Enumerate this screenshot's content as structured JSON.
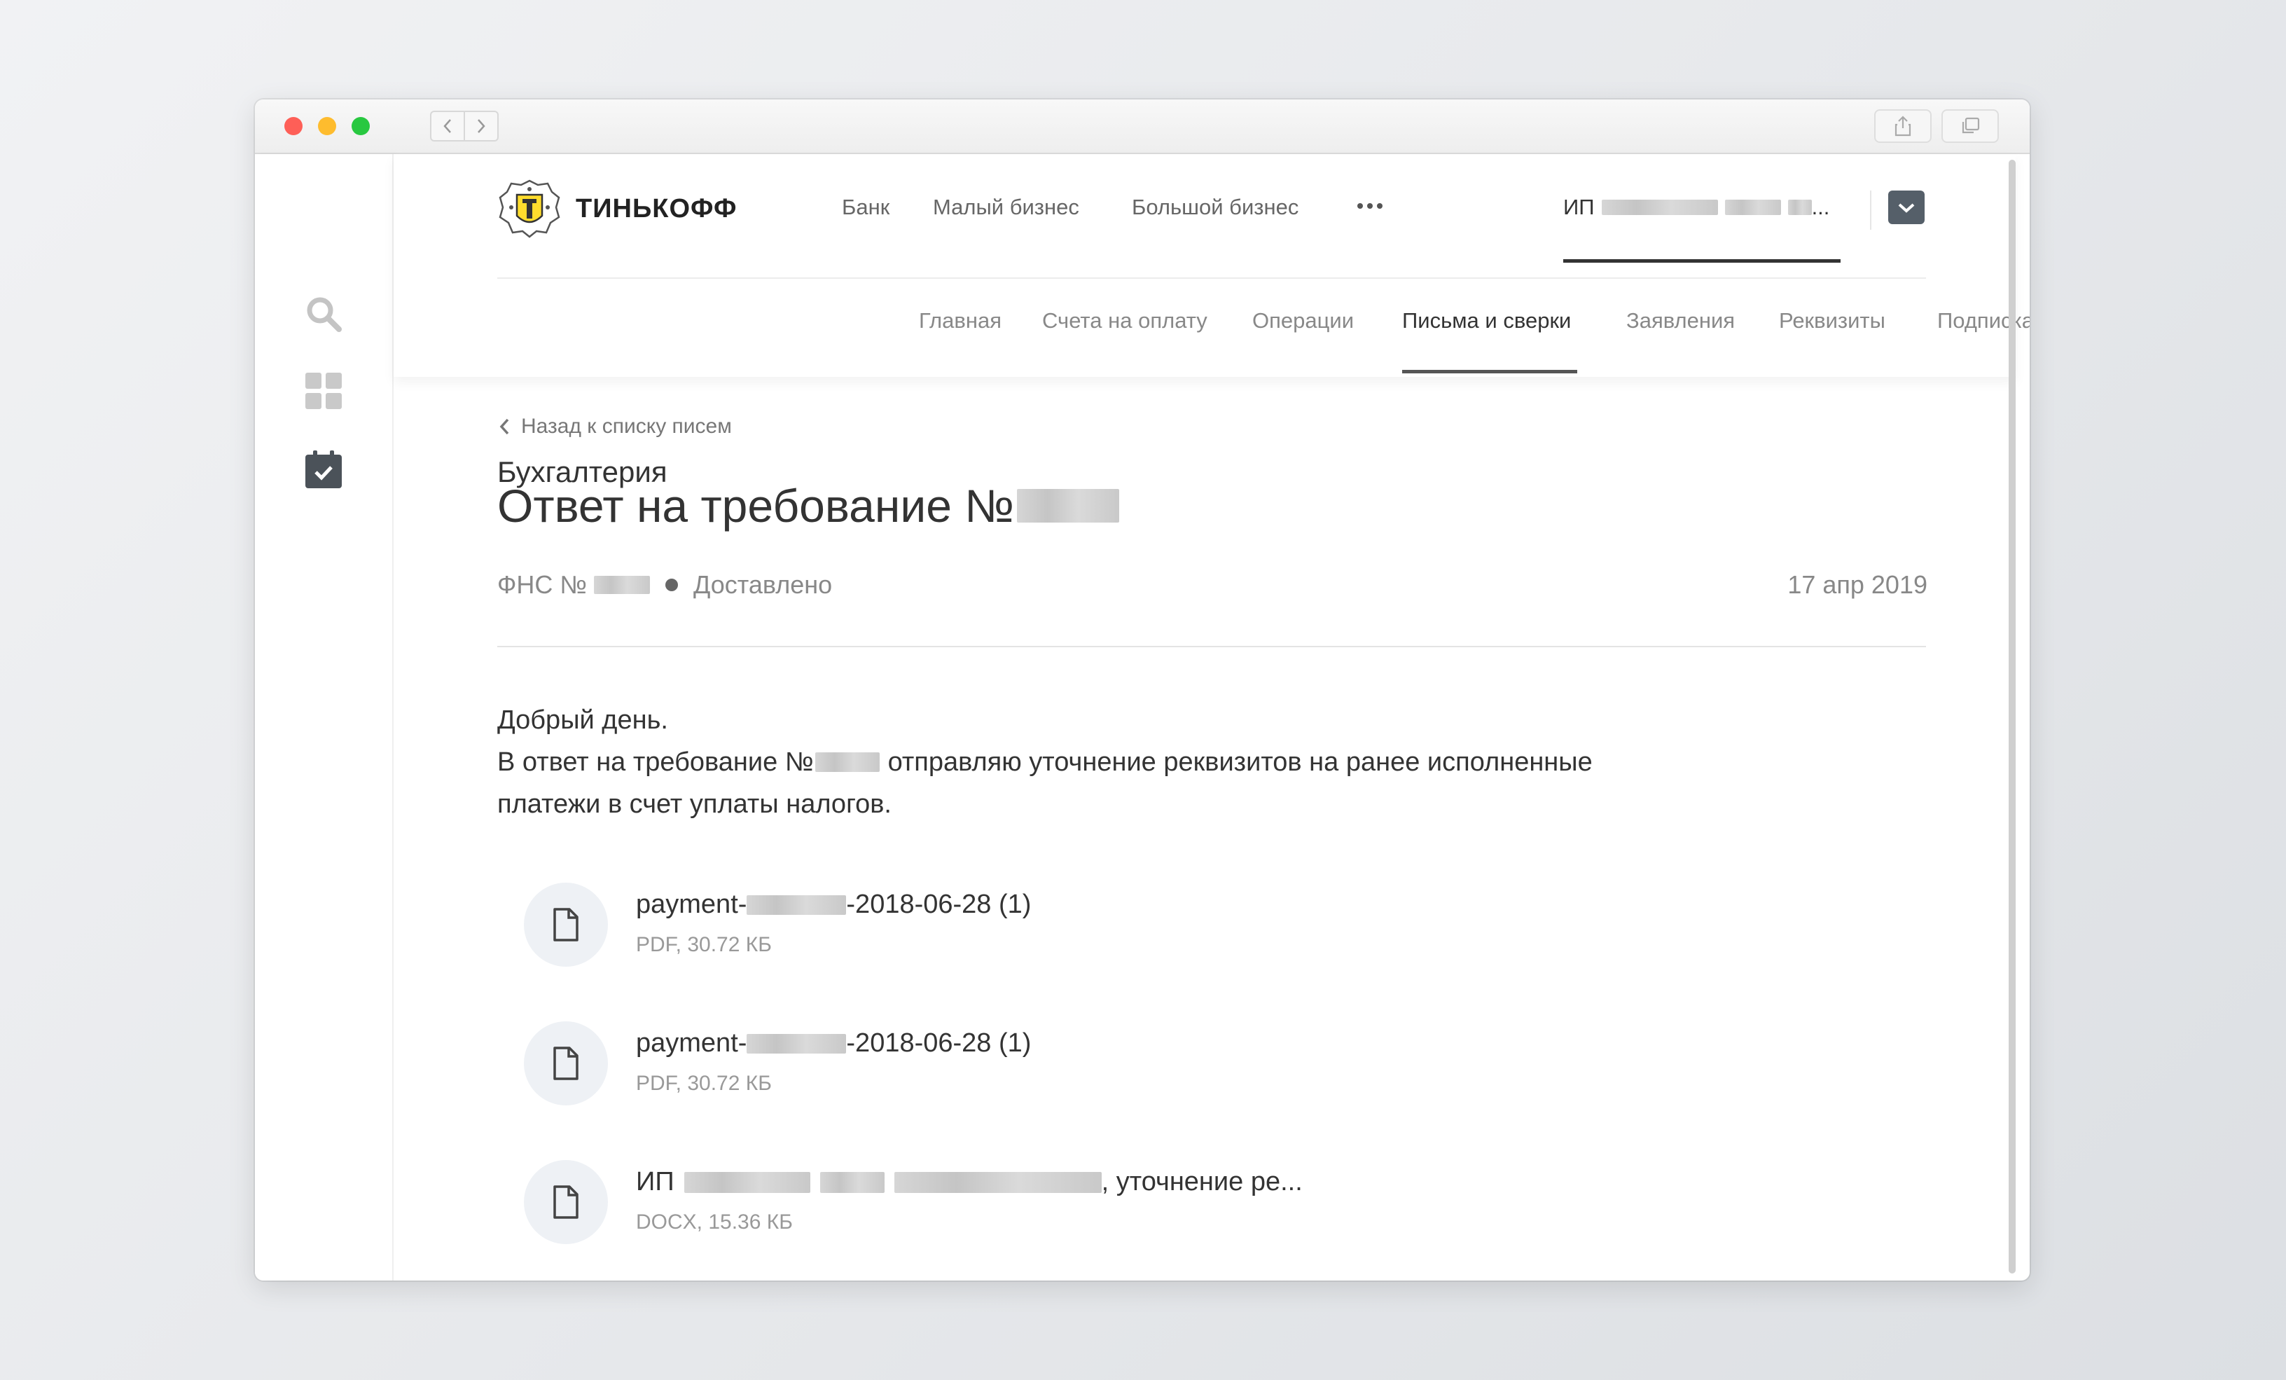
{
  "browser": {
    "window_controls": [
      "close",
      "minimize",
      "maximize"
    ]
  },
  "brand": {
    "name": "ТИНЬКОФФ"
  },
  "main_nav": [
    {
      "label": "Банк"
    },
    {
      "label": "Малый бизнес"
    },
    {
      "label": "Большой бизнес"
    }
  ],
  "user": {
    "prefix": "ИП",
    "suffix": "..."
  },
  "section": {
    "title": "Бухгалтерия",
    "tabs": [
      {
        "label": "Главная"
      },
      {
        "label": "Счета на оплату"
      },
      {
        "label": "Операции"
      },
      {
        "label": "Письма и сверки",
        "active": true
      },
      {
        "label": "Заявления"
      },
      {
        "label": "Реквизиты"
      },
      {
        "label": "Подписка"
      }
    ]
  },
  "letter": {
    "back_label": "Назад к списку писем",
    "title": "Ответ на требование №",
    "recipient_prefix": "ФНС №",
    "status": "Доставлено",
    "date": "17 апр 2019",
    "greeting": "Добрый день.",
    "line2_prefix": "В ответ на требование №",
    "line2_suffix": "отправляю уточнение реквизитов на ранее исполненные",
    "line3": "платежи в счет уплаты налогов.",
    "attachments": [
      {
        "name_prefix": "payment-",
        "name_suffix": "-2018-06-28 (1)",
        "info": "PDF, 30.72 КБ"
      },
      {
        "name_prefix": "payment-",
        "name_suffix": "-2018-06-28 (1)",
        "info": "PDF, 30.72 КБ"
      },
      {
        "name_prefix": "ИП",
        "name_suffix": ", уточнение ре...",
        "info": "DOCX, 15.36 КБ"
      }
    ]
  },
  "colors": {
    "accent_yellow": "#ffdd2d",
    "text": "#333333",
    "muted": "#888888"
  }
}
